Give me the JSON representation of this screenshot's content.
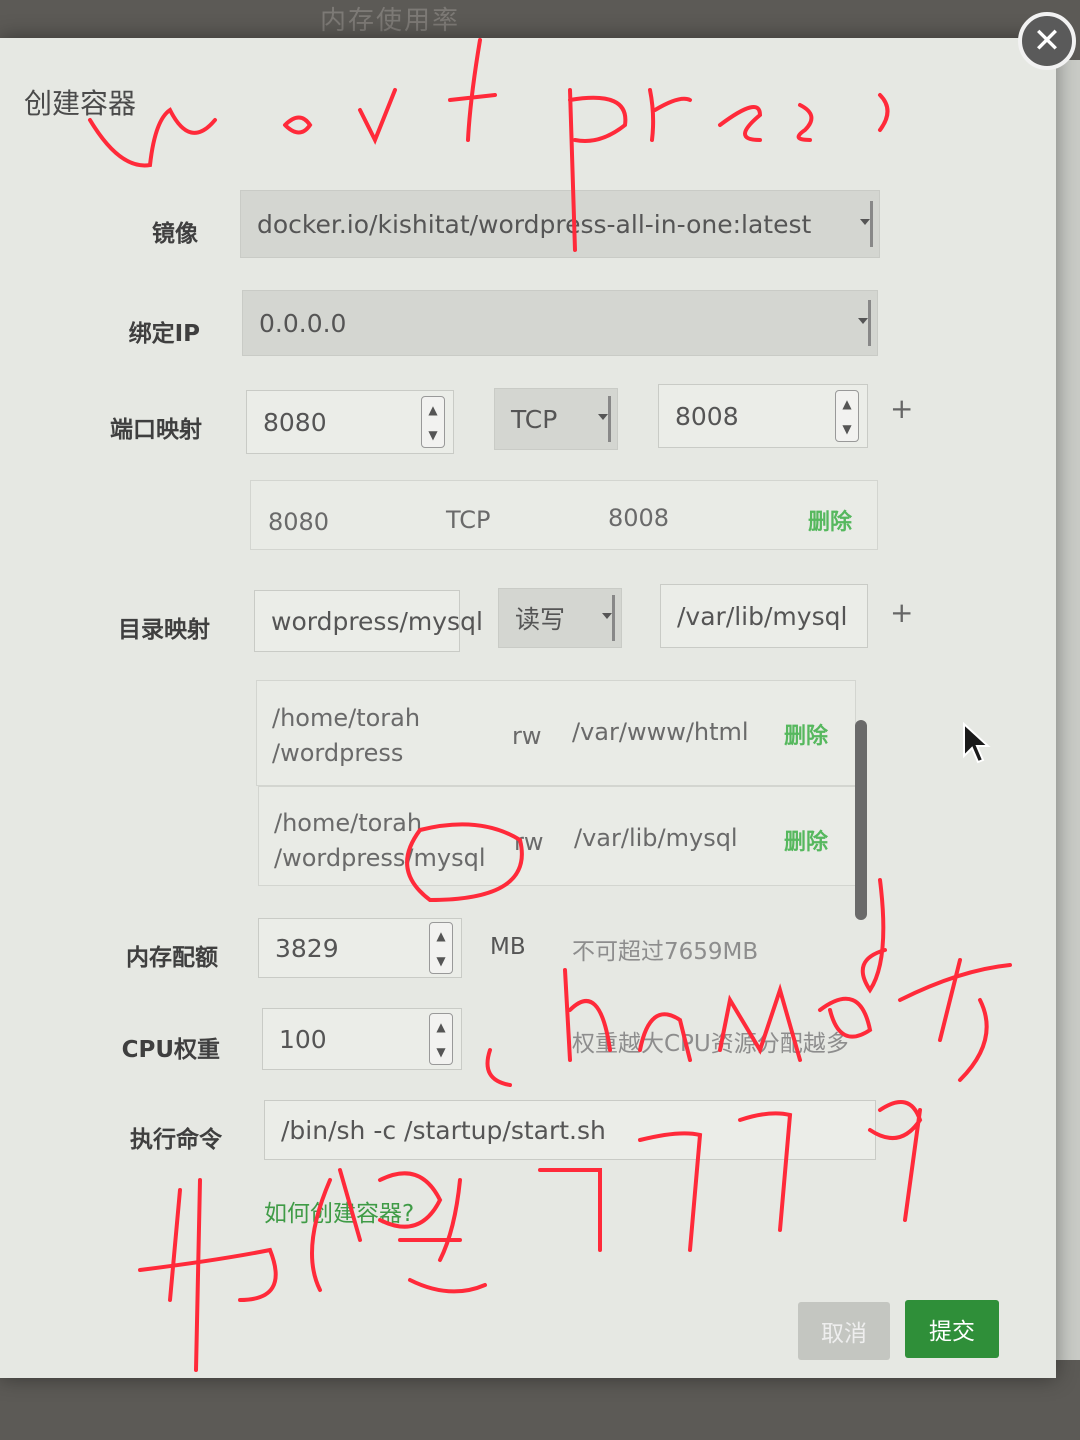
{
  "background": {
    "behind_title": "内存使用率"
  },
  "dialog": {
    "title": "创建容器",
    "close_icon": "close-icon"
  },
  "image": {
    "label": "镜像",
    "value": "docker.io/kishitat/wordpress-all-in-one:latest"
  },
  "bind_ip": {
    "label": "绑定IP",
    "value": "0.0.0.0"
  },
  "port": {
    "label": "端口映射",
    "host": "8080",
    "protocol": "TCP",
    "container": "8008",
    "add": "+",
    "rows": [
      {
        "host": "8080",
        "protocol": "TCP",
        "container": "8008",
        "delete": "删除"
      }
    ]
  },
  "dir": {
    "label": "目录映射",
    "host": "wordpress/mysql",
    "mode": "读写",
    "container": "/var/lib/mysql",
    "add": "+",
    "rows": [
      {
        "host_line1": "/home/torah",
        "host_line2": "/wordpress",
        "mode": "rw",
        "container": "/var/www/html",
        "delete": "删除"
      },
      {
        "host_line1": "/home/torah",
        "host_line2": "/wordpress/mysql",
        "mode": "rw",
        "container": "/var/lib/mysql",
        "delete": "删除"
      }
    ]
  },
  "memory": {
    "label": "内存配额",
    "value": "3829",
    "unit": "MB",
    "hint": "不可超过7659MB"
  },
  "cpu": {
    "label": "CPU权重",
    "value": "100",
    "hint": "权重越大CPU资源分配越多"
  },
  "command": {
    "label": "执行命令",
    "value": "/bin/sh -c /startup/start.sh"
  },
  "help_link": "如何创建容器?",
  "buttons": {
    "cancel": "取消",
    "submit": "提交"
  },
  "colors": {
    "accent": "#2f8f39",
    "link": "#3f9b46",
    "annotation": "#ff2a3a"
  }
}
